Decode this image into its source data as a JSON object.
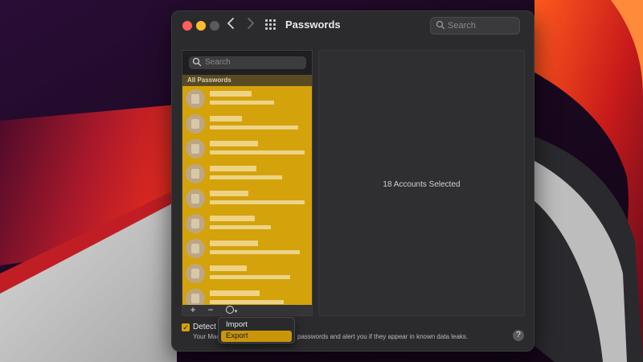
{
  "window": {
    "title": "Passwords"
  },
  "toolbar": {
    "search_placeholder": "Search"
  },
  "list": {
    "search_placeholder": "Search",
    "section_header": "All Passwords",
    "row_count_visible": 9
  },
  "detail": {
    "message": "18 Accounts Selected"
  },
  "list_toolbar": {
    "add_label": "+",
    "remove_label": "−"
  },
  "menu": {
    "items": [
      "Import Passwords...",
      "Export Passwords..."
    ],
    "highlighted_index": 1
  },
  "detect": {
    "label": "Detect c",
    "checked": true,
    "description_left": "Your Mac",
    "description_right": "passwords and alert you if they appear in known data leaks."
  },
  "help_label": "?",
  "colors": {
    "accent": "#d4a20b",
    "window_bg": "#2b2b2d",
    "close": "#ff5f57",
    "minimize": "#febc2e"
  }
}
